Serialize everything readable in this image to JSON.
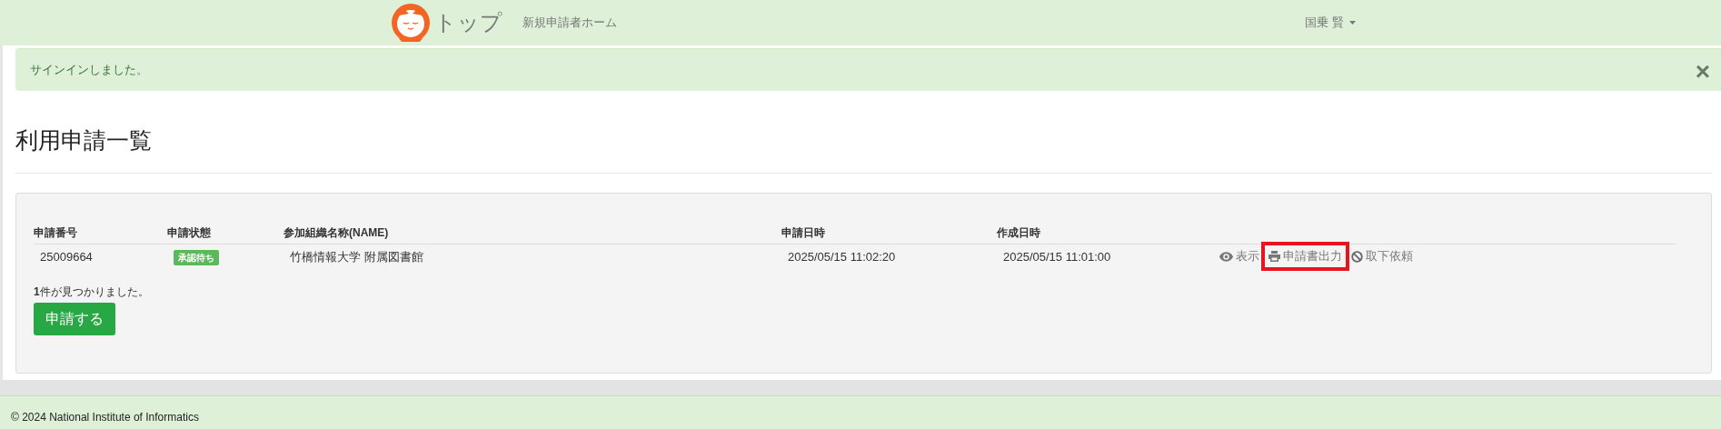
{
  "navbar": {
    "brand": "トップ",
    "links": [
      "新規申請者ホーム"
    ],
    "user": "国乗 賢"
  },
  "alert": {
    "message": "サインインしました。",
    "close": "×"
  },
  "page_title": "利用申請一覧",
  "table": {
    "columns": [
      "申請番号",
      "申請状態",
      "参加組織名称(NAME)",
      "申請日時",
      "作成日時"
    ],
    "rows": [
      {
        "cells": [
          "25009664",
          "承認待ち",
          "竹橋情報大学 附属図書館",
          "2025/05/15 11:02:20",
          "2025/05/15 11:01:00"
        ],
        "actions": [
          {
            "kind": "eye",
            "label": "表示",
            "highlighted": false
          },
          {
            "kind": "print",
            "label": "申請書出力",
            "highlighted": true
          },
          {
            "kind": "ban",
            "label": "取下依頼",
            "highlighted": false
          }
        ]
      }
    ]
  },
  "result_count": "**1**件が見つかりました。",
  "apply_button": "申請する",
  "footer": "© 2024 National Institute of Informatics"
}
